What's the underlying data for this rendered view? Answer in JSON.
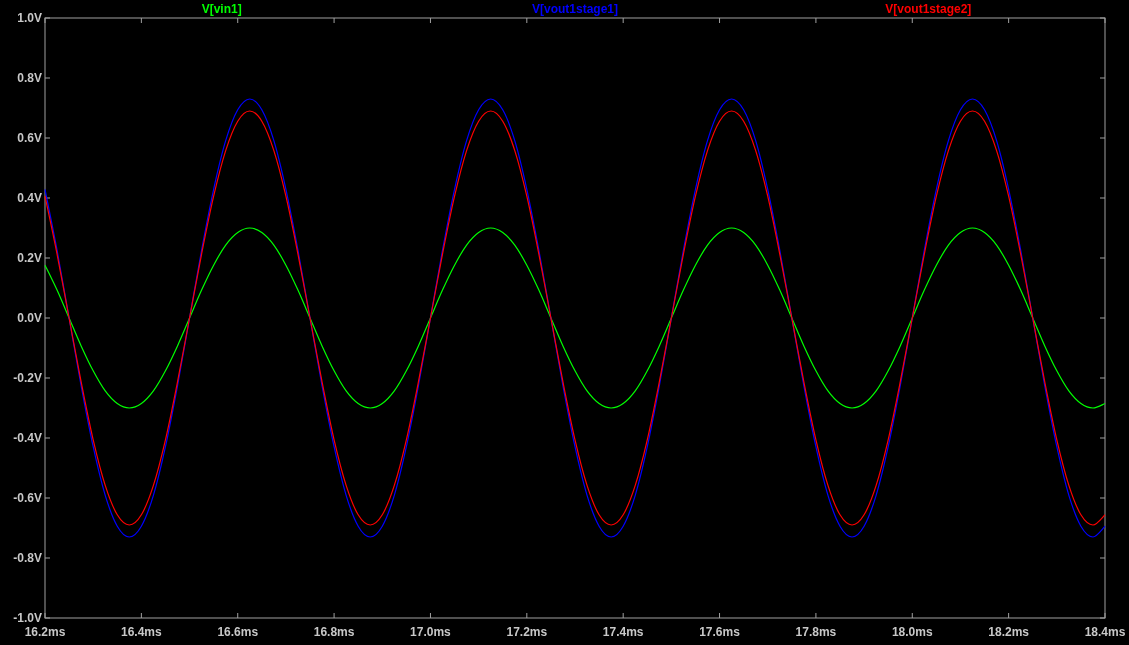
{
  "plot": {
    "chart_data": {
      "type": "line",
      "x": [
        16.2,
        16.225,
        16.25,
        16.275,
        16.3,
        16.325,
        16.35,
        16.375,
        16.4,
        16.425,
        16.45,
        16.475,
        16.5,
        16.525,
        16.55,
        16.575,
        16.6,
        16.625,
        16.65,
        16.675,
        16.7,
        16.725,
        16.75,
        16.775,
        16.8,
        16.825,
        16.85,
        16.875,
        16.9,
        16.925,
        16.95,
        16.975,
        17.0,
        17.025,
        17.05,
        17.075,
        17.1,
        17.125,
        17.15,
        17.175,
        17.2,
        17.225,
        17.25,
        17.275,
        17.3,
        17.325,
        17.35,
        17.375,
        17.4,
        17.425,
        17.45,
        17.475,
        17.5,
        17.525,
        17.55,
        17.575,
        17.6,
        17.625,
        17.65,
        17.675,
        17.7,
        17.725,
        17.75,
        17.775,
        17.8,
        17.825,
        17.85,
        17.875,
        17.9,
        17.925,
        17.95,
        17.975,
        18.0,
        18.025,
        18.05,
        18.075,
        18.1,
        18.125,
        18.15,
        18.175,
        18.2,
        18.225,
        18.25,
        18.275,
        18.3,
        18.325,
        18.35,
        18.375,
        18.4
      ],
      "series": [
        {
          "name": "V[vin1]",
          "color": "#00ff00",
          "values": [
            0.176,
            0.093,
            0,
            -0.093,
            -0.176,
            -0.243,
            -0.285,
            -0.3,
            -0.285,
            -0.243,
            -0.176,
            -0.093,
            0,
            0.093,
            0.176,
            0.243,
            0.285,
            0.3,
            0.285,
            0.243,
            0.176,
            0.093,
            0,
            -0.093,
            -0.176,
            -0.243,
            -0.285,
            -0.3,
            -0.285,
            -0.243,
            -0.176,
            -0.093,
            0,
            0.093,
            0.176,
            0.243,
            0.285,
            0.3,
            0.285,
            0.243,
            0.176,
            0.093,
            0,
            -0.093,
            -0.176,
            -0.243,
            -0.285,
            -0.3,
            -0.285,
            -0.243,
            -0.176,
            -0.093,
            0,
            0.093,
            0.176,
            0.243,
            0.285,
            0.3,
            0.285,
            0.243,
            0.176,
            0.093,
            0,
            -0.093,
            -0.176,
            -0.243,
            -0.285,
            -0.3,
            -0.285,
            -0.243,
            -0.176,
            -0.093,
            0,
            0.093,
            0.176,
            0.243,
            0.285,
            0.3,
            0.285,
            0.243,
            0.176,
            0.093,
            0,
            -0.093,
            -0.176,
            -0.243,
            -0.285,
            -0.3,
            -0.285
          ]
        },
        {
          "name": "V[vout1stage1]",
          "color": "#0000ff",
          "values": [
            0.429,
            0.226,
            0,
            -0.226,
            -0.429,
            -0.591,
            -0.694,
            -0.73,
            -0.694,
            -0.591,
            -0.429,
            -0.226,
            0,
            0.226,
            0.429,
            0.591,
            0.694,
            0.73,
            0.694,
            0.591,
            0.429,
            0.226,
            0,
            -0.226,
            -0.429,
            -0.591,
            -0.694,
            -0.73,
            -0.694,
            -0.591,
            -0.429,
            -0.226,
            0,
            0.226,
            0.429,
            0.591,
            0.694,
            0.73,
            0.694,
            0.591,
            0.429,
            0.226,
            0,
            -0.226,
            -0.429,
            -0.591,
            -0.694,
            -0.73,
            -0.694,
            -0.591,
            -0.429,
            -0.226,
            0,
            0.226,
            0.429,
            0.591,
            0.694,
            0.73,
            0.694,
            0.591,
            0.429,
            0.226,
            0,
            -0.226,
            -0.429,
            -0.591,
            -0.694,
            -0.73,
            -0.694,
            -0.591,
            -0.429,
            -0.226,
            0,
            0.226,
            0.429,
            0.591,
            0.694,
            0.73,
            0.694,
            0.591,
            0.429,
            0.226,
            0,
            -0.226,
            -0.429,
            -0.591,
            -0.694,
            -0.73,
            -0.694
          ]
        },
        {
          "name": "V[vout1stage2]",
          "color": "#ff0000",
          "values": [
            0.406,
            0.213,
            0,
            -0.213,
            -0.406,
            -0.558,
            -0.656,
            -0.69,
            -0.656,
            -0.558,
            -0.406,
            -0.213,
            0,
            0.213,
            0.406,
            0.558,
            0.656,
            0.69,
            0.656,
            0.558,
            0.406,
            0.213,
            0,
            -0.213,
            -0.406,
            -0.558,
            -0.656,
            -0.69,
            -0.656,
            -0.558,
            -0.406,
            -0.213,
            0,
            0.213,
            0.406,
            0.558,
            0.656,
            0.69,
            0.656,
            0.558,
            0.406,
            0.213,
            0,
            -0.213,
            -0.406,
            -0.558,
            -0.656,
            -0.69,
            -0.656,
            -0.558,
            -0.406,
            -0.213,
            0,
            0.213,
            0.406,
            0.558,
            0.656,
            0.69,
            0.656,
            0.558,
            0.406,
            0.213,
            0,
            -0.213,
            -0.406,
            -0.558,
            -0.656,
            -0.69,
            -0.656,
            -0.558,
            -0.406,
            -0.213,
            0,
            0.213,
            0.406,
            0.558,
            0.656,
            0.69,
            0.656,
            0.558,
            0.406,
            0.213,
            0,
            -0.213,
            -0.406,
            -0.558,
            -0.656,
            -0.69,
            -0.656
          ]
        }
      ],
      "xlim": [
        16.2,
        18.4
      ],
      "ylim": [
        -1.0,
        1.0
      ],
      "xticks": [
        {
          "value": 16.2,
          "label": "16.2ms"
        },
        {
          "value": 16.4,
          "label": "16.4ms"
        },
        {
          "value": 16.6,
          "label": "16.6ms"
        },
        {
          "value": 16.8,
          "label": "16.8ms"
        },
        {
          "value": 17.0,
          "label": "17.0ms"
        },
        {
          "value": 17.2,
          "label": "17.2ms"
        },
        {
          "value": 17.4,
          "label": "17.4ms"
        },
        {
          "value": 17.6,
          "label": "17.6ms"
        },
        {
          "value": 17.8,
          "label": "17.8ms"
        },
        {
          "value": 18.0,
          "label": "18.0ms"
        },
        {
          "value": 18.2,
          "label": "18.2ms"
        },
        {
          "value": 18.4,
          "label": "18.4ms"
        }
      ],
      "yticks": [
        {
          "value": 1.0,
          "label": "1.0V"
        },
        {
          "value": 0.8,
          "label": "0.8V"
        },
        {
          "value": 0.6,
          "label": "0.6V"
        },
        {
          "value": 0.4,
          "label": "0.4V"
        },
        {
          "value": 0.2,
          "label": "0.2V"
        },
        {
          "value": 0.0,
          "label": "0.0V"
        },
        {
          "value": -0.2,
          "label": "-0.2V"
        },
        {
          "value": -0.4,
          "label": "-0.4V"
        },
        {
          "value": -0.6,
          "label": "-0.6V"
        },
        {
          "value": -0.8,
          "label": "-0.8V"
        },
        {
          "value": -1.0,
          "label": "-1.0V"
        }
      ]
    }
  }
}
